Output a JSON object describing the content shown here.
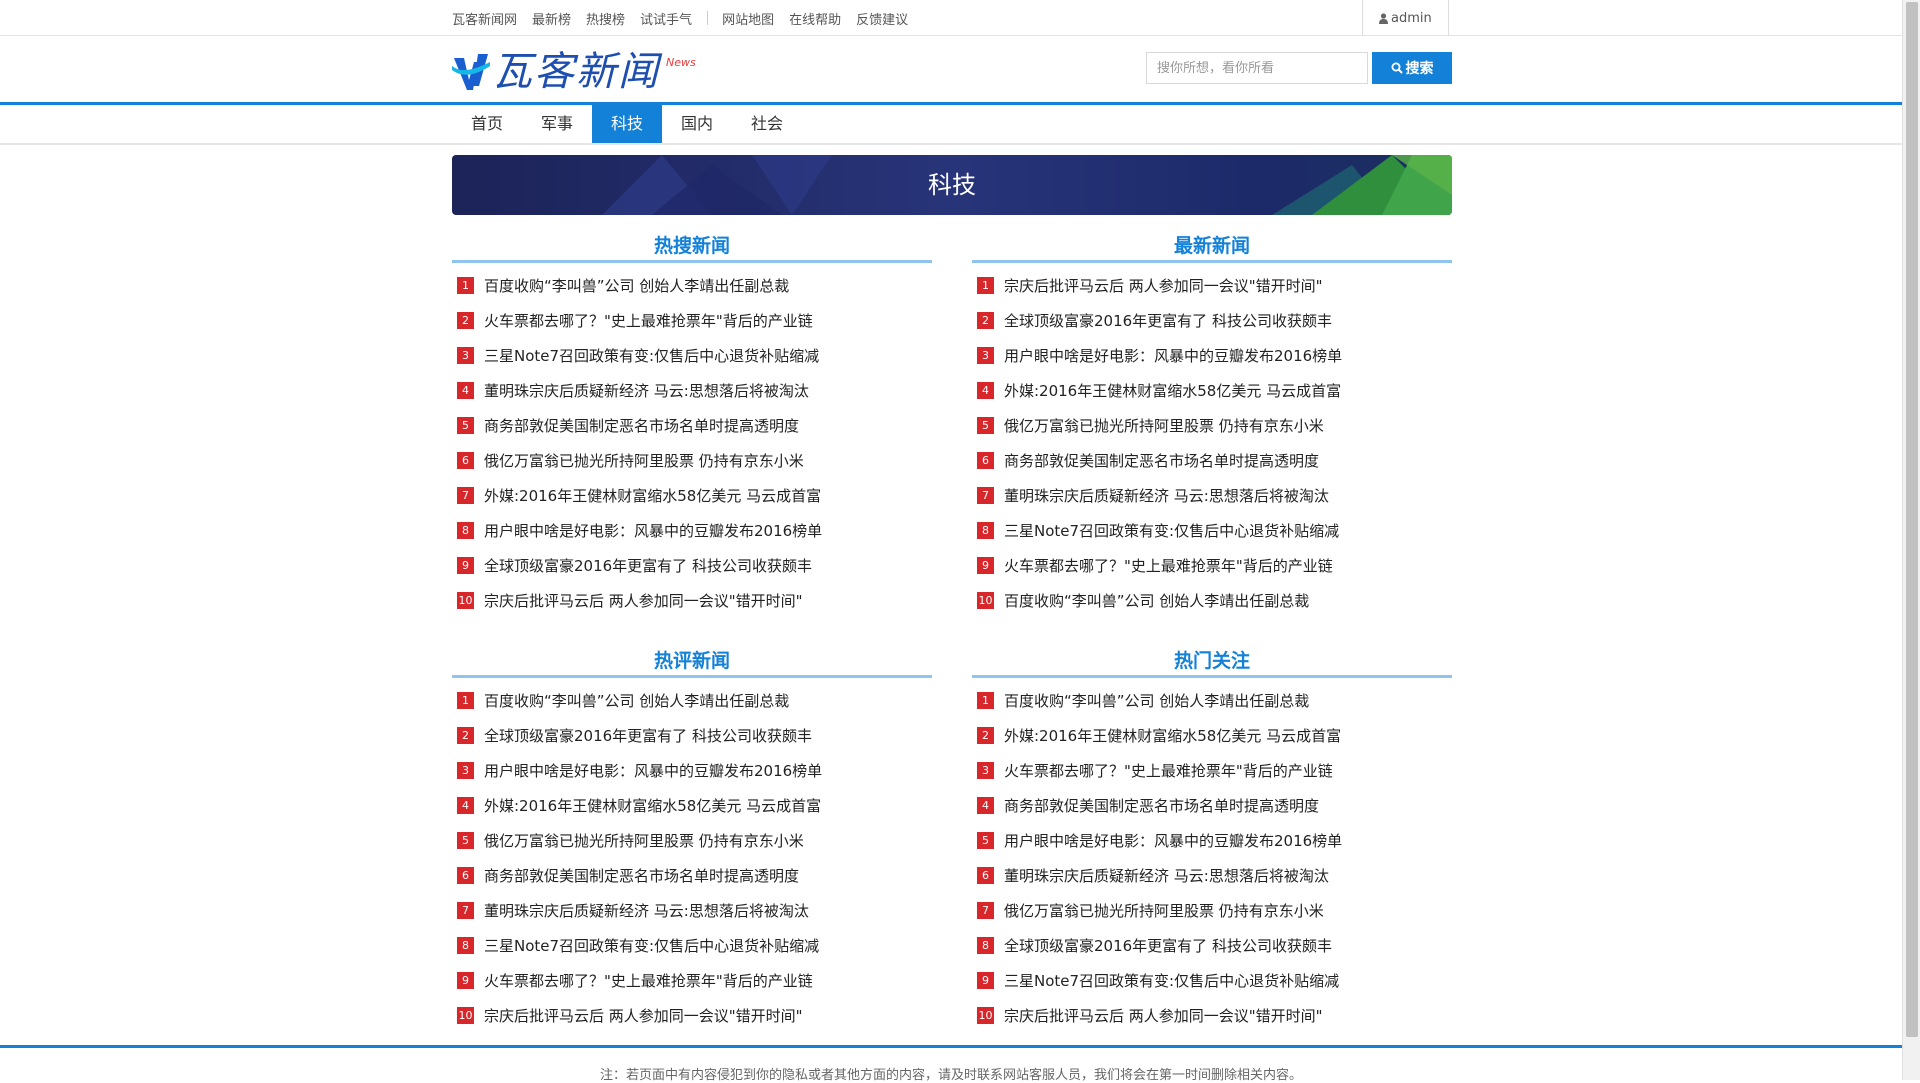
{
  "topbar": {
    "links": [
      "瓦客新闻网",
      "最新榜",
      "热搜榜",
      "试试手气"
    ],
    "links2": [
      "网站地图",
      "在线帮助",
      "反馈建议"
    ],
    "user": "admin"
  },
  "header": {
    "logo_text": "瓦客新闻",
    "logo_badge": "News",
    "search_placeholder": "搜你所想，看你所看",
    "search_button": "搜索"
  },
  "nav": {
    "items": [
      "首页",
      "军事",
      "科技",
      "国内",
      "社会"
    ],
    "active": "科技"
  },
  "banner": {
    "title": "科技"
  },
  "sections": [
    {
      "title": "热搜新闻",
      "items": [
        "百度收购“李叫兽”公司 创始人李靖出任副总裁",
        "火车票都去哪了？\"史上最难抢票年\"背后的产业链",
        "三星Note7召回政策有变:仅售后中心退货补贴缩减",
        "董明珠宗庆后质疑新经济 马云:思想落后将被淘汰",
        "商务部敦促美国制定恶名市场名单时提高透明度",
        "俄亿万富翁已抛光所持阿里股票 仍持有京东小米",
        "外媒:2016年王健林财富缩水58亿美元 马云成首富",
        "用户眼中啥是好电影：风暴中的豆瓣发布2016榜单",
        "全球顶级富豪2016年更富有了 科技公司收获颇丰",
        "宗庆后批评马云后 两人参加同一会议\"错开时间\""
      ]
    },
    {
      "title": "最新新闻",
      "items": [
        "宗庆后批评马云后 两人参加同一会议\"错开时间\"",
        "全球顶级富豪2016年更富有了 科技公司收获颇丰",
        "用户眼中啥是好电影：风暴中的豆瓣发布2016榜单",
        "外媒:2016年王健林财富缩水58亿美元 马云成首富",
        "俄亿万富翁已抛光所持阿里股票 仍持有京东小米",
        "商务部敦促美国制定恶名市场名单时提高透明度",
        "董明珠宗庆后质疑新经济 马云:思想落后将被淘汰",
        "三星Note7召回政策有变:仅售后中心退货补贴缩减",
        "火车票都去哪了？\"史上最难抢票年\"背后的产业链",
        "百度收购“李叫兽”公司 创始人李靖出任副总裁"
      ]
    },
    {
      "title": "热评新闻",
      "items": [
        "百度收购“李叫兽”公司 创始人李靖出任副总裁",
        "全球顶级富豪2016年更富有了 科技公司收获颇丰",
        "用户眼中啥是好电影：风暴中的豆瓣发布2016榜单",
        "外媒:2016年王健林财富缩水58亿美元 马云成首富",
        "俄亿万富翁已抛光所持阿里股票 仍持有京东小米",
        "商务部敦促美国制定恶名市场名单时提高透明度",
        "董明珠宗庆后质疑新经济 马云:思想落后将被淘汰",
        "三星Note7召回政策有变:仅售后中心退货补贴缩减",
        "火车票都去哪了？\"史上最难抢票年\"背后的产业链",
        "宗庆后批评马云后 两人参加同一会议\"错开时间\""
      ]
    },
    {
      "title": "热门关注",
      "items": [
        "百度收购“李叫兽”公司 创始人李靖出任副总裁",
        "外媒:2016年王健林财富缩水58亿美元 马云成首富",
        "火车票都去哪了？\"史上最难抢票年\"背后的产业链",
        "商务部敦促美国制定恶名市场名单时提高透明度",
        "用户眼中啥是好电影：风暴中的豆瓣发布2016榜单",
        "董明珠宗庆后质疑新经济 马云:思想落后将被淘汰",
        "俄亿万富翁已抛光所持阿里股票 仍持有京东小米",
        "全球顶级富豪2016年更富有了 科技公司收获颇丰",
        "三星Note7召回政策有变:仅售后中心退货补贴缩减",
        "宗庆后批评马云后 两人参加同一会议\"错开时间\""
      ]
    }
  ],
  "footer": {
    "note": "注：若页面中有内容侵犯到你的隐私或者其他方面的内容，请及时联系网站客服人员，我们将会在第一时间删除相关内容。"
  },
  "colors": {
    "accent": "#1481d8",
    "rank": "#d7272b",
    "banner": "#232c6b"
  }
}
